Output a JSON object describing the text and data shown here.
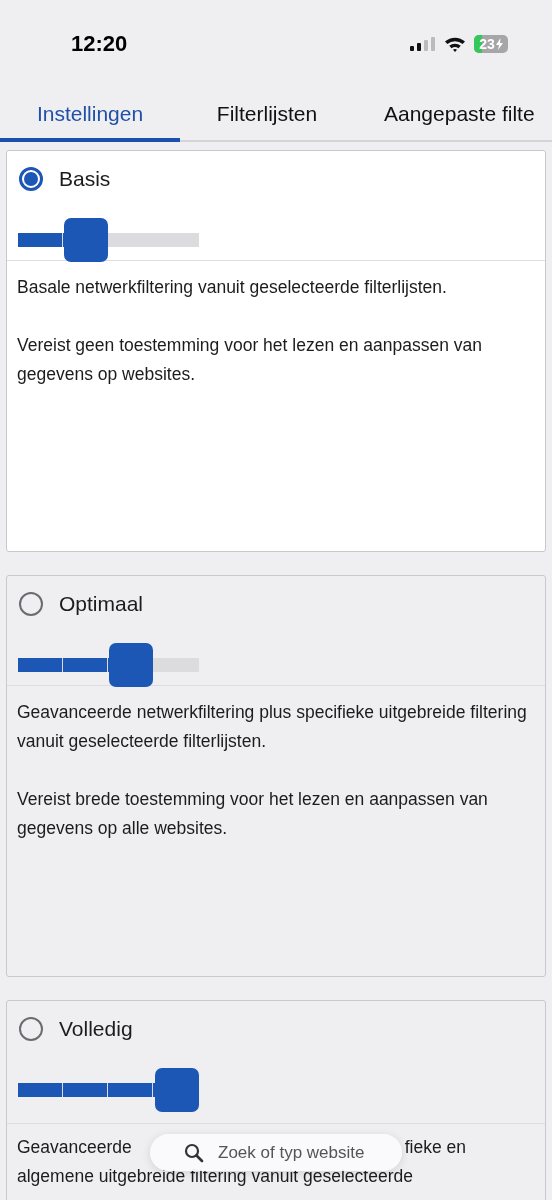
{
  "status_bar": {
    "time": "12:20",
    "battery": "23"
  },
  "tabs": [
    {
      "label": "Instellingen",
      "selected": true
    },
    {
      "label": "Filterlijsten",
      "selected": false
    },
    {
      "label": "Aangepaste filte",
      "selected": false
    }
  ],
  "modes": [
    {
      "label": "Basis",
      "selected": true,
      "level": 0.3333,
      "paragraphs": [
        "Basale netwerkfiltering vanuit geselecteerde filterlijsten.",
        "Vereist geen toestemming voor het lezen en aanpassen van gegevens op websites."
      ]
    },
    {
      "label": "Optimaal",
      "selected": false,
      "level": 0.6667,
      "paragraphs": [
        "Geavanceerde netwerkfiltering plus specifieke uitgebreide filtering vanuit geselecteerde filterlijsten.",
        "Vereist brede toestemming voor het lezen en aanpassen van gegevens op alle websites."
      ]
    },
    {
      "label": "Volledig",
      "selected": false,
      "level": 1,
      "lines": [
        [
          "Geavanceerde",
          "fieke en"
        ],
        [
          "algemene uitgebreide filtering vanuit geselecteerde"
        ]
      ]
    }
  ],
  "search": {
    "placeholder": "Zoek of typ website"
  }
}
